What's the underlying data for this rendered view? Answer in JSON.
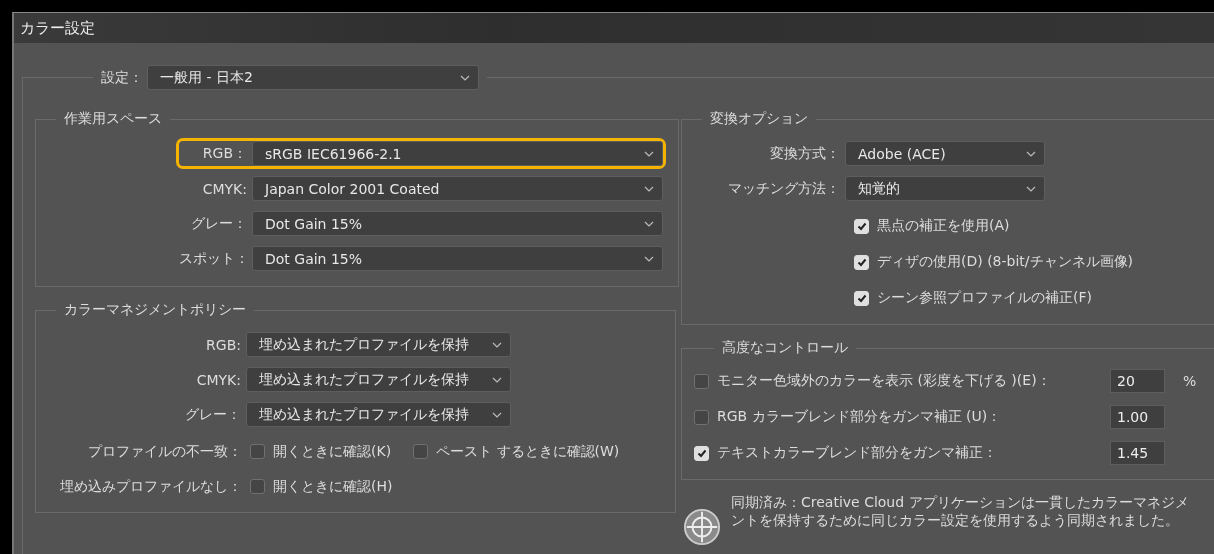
{
  "window": {
    "title": "カラー設定"
  },
  "settings": {
    "label": "設定：",
    "value": "一般用 - 日本2"
  },
  "working_spaces": {
    "title": "作業用スペース",
    "rows": [
      {
        "label": "RGB：",
        "value": "sRGB IEC61966-2.1",
        "highlighted": true
      },
      {
        "label": "CMYK:",
        "value": "Japan Color 2001 Coated",
        "highlighted": false
      },
      {
        "label": "グレー：",
        "value": "Dot Gain 15%",
        "highlighted": false
      },
      {
        "label": "スポット：",
        "value": "Dot Gain 15%",
        "highlighted": false
      }
    ]
  },
  "color_management_policies": {
    "title": "カラーマネジメントポリシー",
    "rows": [
      {
        "label": "RGB:",
        "value": "埋め込まれたプロファイルを保持"
      },
      {
        "label": "CMYK:",
        "value": "埋め込まれたプロファイルを保持"
      },
      {
        "label": "グレー：",
        "value": "埋め込まれたプロファイルを保持"
      }
    ],
    "check_rows": [
      {
        "label": "プロファイルの不一致：",
        "options": [
          {
            "label": "開くときに確認(K)",
            "checked": false
          },
          {
            "label": "ペースト するときに確認(W)",
            "checked": false
          }
        ]
      },
      {
        "label": "埋め込みプロファイルなし：",
        "options": [
          {
            "label": "開くときに確認(H)",
            "checked": false
          }
        ]
      }
    ]
  },
  "conversion_options": {
    "title": "変換オプション",
    "rows": [
      {
        "label": "変換方式：",
        "value": "Adobe (ACE)"
      },
      {
        "label": "マッチング方法：",
        "value": "知覚的"
      }
    ],
    "checkboxes": [
      {
        "label": "黒点の補正を使用(A)",
        "checked": true
      },
      {
        "label": "ディザの使用(D) (8-bit/チャンネル画像)",
        "checked": true
      },
      {
        "label": "シーン参照プロファイルの補正(F)",
        "checked": true
      }
    ]
  },
  "advanced_controls": {
    "title": "高度なコントロール",
    "rows": [
      {
        "label": "モニター色域外のカラーを表示 (彩度を下げる )(E)：",
        "checked": false,
        "value": "20",
        "unit": "%"
      },
      {
        "label": "RGB カラーブレンド部分をガンマ補正 (U)：",
        "checked": false,
        "value": "1.00"
      },
      {
        "label": "テキストカラーブレンド部分をガンマ補正：",
        "checked": true,
        "value": "1.45"
      }
    ]
  },
  "sync_message": "同期済み：Creative Cloud アプリケーションは一貫したカラーマネジメントを保持するために同じカラー設定を使用するよう同期されました。"
}
